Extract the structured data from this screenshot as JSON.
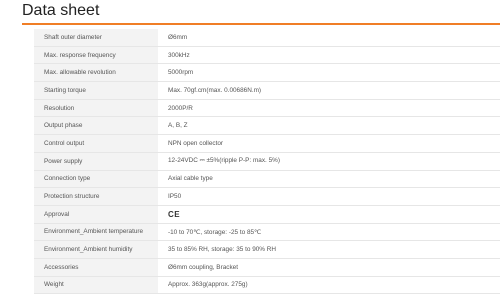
{
  "page": {
    "title": "Data sheet",
    "accent_color": "#f07e26"
  },
  "spec_rows": [
    {
      "label": "Shaft outer diameter",
      "value": "Ø6mm"
    },
    {
      "label": "Max. response frequency",
      "value": "300kHz"
    },
    {
      "label": "Max. allowable revolution",
      "value": "5000rpm"
    },
    {
      "label": "Starting torque",
      "value": "Max. 70gf.cm(max. 0.00686N.m)"
    },
    {
      "label": "Resolution",
      "value": "2000P/R"
    },
    {
      "label": "Output phase",
      "value": "A, B, Z"
    },
    {
      "label": "Control output",
      "value": "NPN open collector"
    },
    {
      "label": "Power supply",
      "value": "12-24VDC ⎓ ±5%(ripple P-P: max. 5%)"
    },
    {
      "label": "Connection type",
      "value": "Axial cable type"
    },
    {
      "label": "Protection structure",
      "value": "IP50"
    },
    {
      "label": "Approval",
      "value": "CE"
    },
    {
      "label": "Environment_Ambient temperature",
      "value": "-10 to 70℃, storage: -25 to 85℃"
    },
    {
      "label": "Environment_Ambient humidity",
      "value": "35 to 85% RH, storage: 35 to 90% RH"
    },
    {
      "label": "Accessories",
      "value": "Ø6mm coupling, Bracket"
    },
    {
      "label": "Weight",
      "value": "Approx. 363g(approx. 275g)"
    }
  ]
}
